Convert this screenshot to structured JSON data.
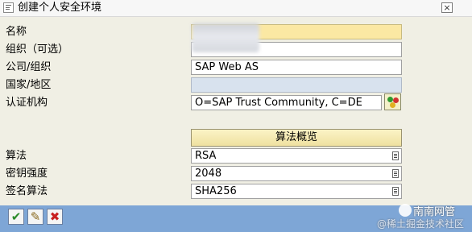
{
  "window": {
    "title": "创建个人安全环境",
    "close_label": "×"
  },
  "form": {
    "rows": [
      {
        "label": "名称",
        "value": ""
      },
      {
        "label": "组织（可选）",
        "value": ""
      },
      {
        "label": "公司/组织",
        "value": "SAP Web AS"
      },
      {
        "label": "国家/地区",
        "value": ""
      },
      {
        "label": "认证机构",
        "value": "O=SAP Trust Community, C=DE"
      }
    ],
    "algo_overview_label": "算法概览",
    "algo_rows": [
      {
        "label": "算法",
        "value": "RSA"
      },
      {
        "label": "密钥强度",
        "value": "2048"
      },
      {
        "label": "签名算法",
        "value": "SHA256"
      }
    ]
  },
  "footer": {
    "buttons": [
      {
        "icon": "check-icon",
        "glyph": "✔",
        "color": "#2a8a2a"
      },
      {
        "icon": "pencil-icon",
        "glyph": "✎",
        "color": "#8a6a20"
      },
      {
        "icon": "cancel-icon",
        "glyph": "✖",
        "color": "#c82020"
      }
    ]
  },
  "watermark": {
    "line1": "南南网管",
    "line2": "@稀土掘金技术社区"
  },
  "colors": {
    "required_field": "#fbe8a3",
    "readonly_field": "#d8e2ee",
    "footer_bar": "#7ea6d6",
    "button_face": "#efe1a0"
  }
}
